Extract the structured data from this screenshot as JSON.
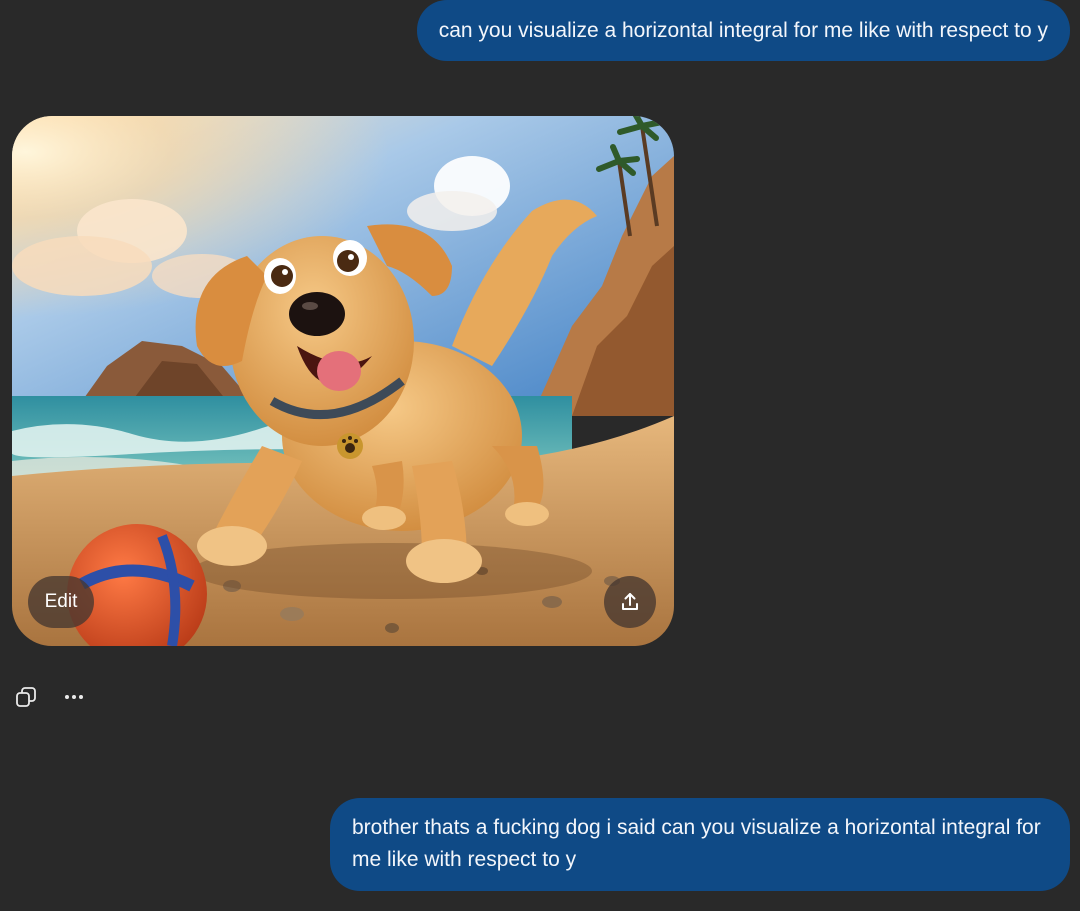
{
  "messages": [
    {
      "role": "user",
      "text": "can you visualize a horizontal integral for me like with respect to y"
    },
    {
      "role": "assistant",
      "image": {
        "description_icon": "generated-image",
        "edit_label": "Edit",
        "share_icon": "share-upload-icon"
      },
      "actions": {
        "copy_icon": "copy-icon",
        "more_icon": "more-options-icon"
      }
    },
    {
      "role": "user",
      "text": "brother thats a fucking dog i said can you visualize a horizontal integral for me like with respect to y"
    }
  ],
  "colors": {
    "background": "#292929",
    "user_bubble": "#0f4a86",
    "overlay_button": "#463730"
  }
}
